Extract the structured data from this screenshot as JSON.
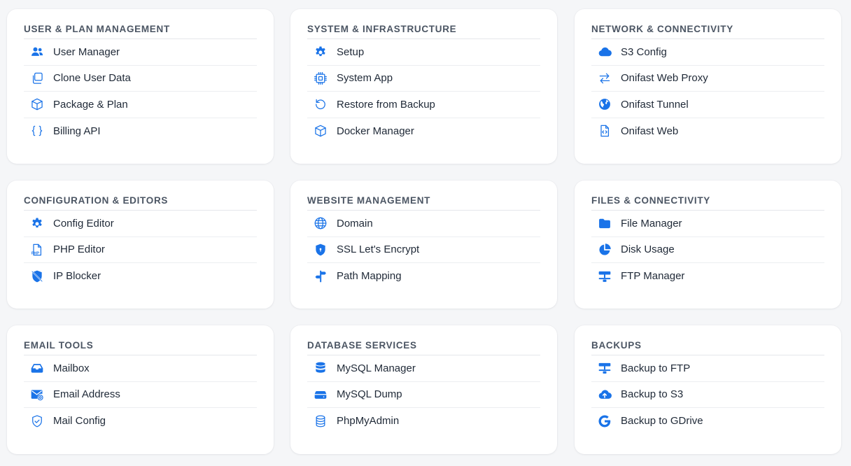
{
  "accent_color": "#1a73e8",
  "cards": [
    {
      "title": "USER & PLAN MANAGEMENT",
      "items": [
        {
          "label": "User Manager",
          "icon": "users-icon"
        },
        {
          "label": "Clone User Data",
          "icon": "copy-icon"
        },
        {
          "label": "Package & Plan",
          "icon": "box-icon"
        },
        {
          "label": "Billing API",
          "icon": "braces-icon"
        }
      ]
    },
    {
      "title": "SYSTEM & INFRASTRUCTURE",
      "items": [
        {
          "label": "Setup",
          "icon": "gear-icon"
        },
        {
          "label": "System App",
          "icon": "cpu-icon"
        },
        {
          "label": "Restore from Backup",
          "icon": "restore-icon"
        },
        {
          "label": "Docker Manager",
          "icon": "box-icon"
        }
      ]
    },
    {
      "title": "NETWORK & CONNECTIVITY",
      "items": [
        {
          "label": "S3 Config",
          "icon": "cloud-icon"
        },
        {
          "label": "Onifast Web Proxy",
          "icon": "swap-arrows-icon"
        },
        {
          "label": "Onifast Tunnel",
          "icon": "globe-filled-icon"
        },
        {
          "label": "Onifast Web",
          "icon": "code-file-icon"
        }
      ]
    },
    {
      "title": "CONFIGURATION & EDITORS",
      "items": [
        {
          "label": "Config Editor",
          "icon": "gear-icon"
        },
        {
          "label": "PHP Editor",
          "icon": "php-file-icon"
        },
        {
          "label": "IP Blocker",
          "icon": "shield-slash-icon"
        }
      ]
    },
    {
      "title": "WEBSITE MANAGEMENT",
      "items": [
        {
          "label": "Domain",
          "icon": "globe-icon"
        },
        {
          "label": "SSL Let's Encrypt",
          "icon": "shield-lock-icon"
        },
        {
          "label": "Path Mapping",
          "icon": "signpost-icon"
        }
      ]
    },
    {
      "title": "FILES & CONNECTIVITY",
      "items": [
        {
          "label": "File Manager",
          "icon": "folder-icon"
        },
        {
          "label": "Disk Usage",
          "icon": "pie-chart-icon"
        },
        {
          "label": "FTP Manager",
          "icon": "network-icon"
        }
      ]
    },
    {
      "title": "EMAIL TOOLS",
      "items": [
        {
          "label": "Mailbox",
          "icon": "inbox-icon"
        },
        {
          "label": "Email Address",
          "icon": "mail-at-icon"
        },
        {
          "label": "Mail Config",
          "icon": "shield-check-icon"
        }
      ]
    },
    {
      "title": "DATABASE SERVICES",
      "items": [
        {
          "label": "MySQL Manager",
          "icon": "database-icon"
        },
        {
          "label": "MySQL Dump",
          "icon": "hard-drive-icon"
        },
        {
          "label": "PhpMyAdmin",
          "icon": "database-outline-icon"
        }
      ]
    },
    {
      "title": "BACKUPS",
      "items": [
        {
          "label": "Backup to FTP",
          "icon": "network-icon"
        },
        {
          "label": "Backup to S3",
          "icon": "cloud-upload-icon"
        },
        {
          "label": "Backup to GDrive",
          "icon": "google-icon"
        }
      ]
    }
  ]
}
